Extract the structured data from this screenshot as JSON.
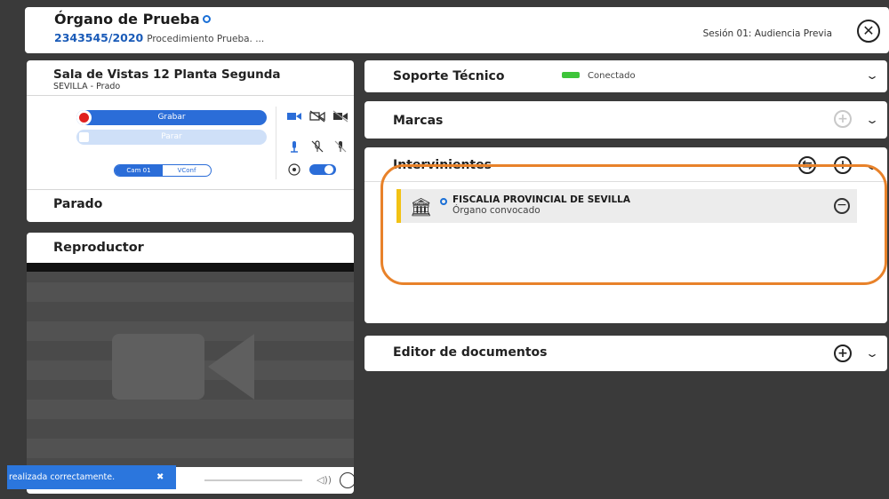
{
  "header": {
    "org_name": "Órgano de Prueba",
    "case_number": "2343545/2020",
    "case_description": "Procedimiento Prueba. ...",
    "session": "Sesión 01: Audiencia Previa",
    "close_label": "✕"
  },
  "room": {
    "name": "Sala de Vistas 12 Planta Segunda",
    "location": "SEVILLA - Prado",
    "record_label": "Grabar",
    "stop_label": "Parar",
    "camera_toggle": [
      "Cam 01",
      "VConf"
    ],
    "status": "Parado"
  },
  "player": {
    "title": "Reproductor"
  },
  "toast": {
    "message": "realizada correctamente.",
    "close": "✖"
  },
  "sections": {
    "support": {
      "title": "Soporte Técnico",
      "status": "Conectado",
      "status_color": "#3ec43a"
    },
    "marks": {
      "title": "Marcas",
      "add": "+"
    },
    "interveners": {
      "title": "Intervinientes",
      "add": "+",
      "swap": "⇆",
      "participants": [
        {
          "name": "FISCALIA PROVINCIAL DE SEVILLA",
          "role": "Órgano convocado",
          "remove": "−",
          "icon": "institution-icon"
        }
      ]
    },
    "editor": {
      "title": "Editor de documentos",
      "add": "+"
    }
  },
  "colors": {
    "accent": "#2b6dd8",
    "highlight": "#e8822a",
    "participant_bar": "#f2c214"
  }
}
